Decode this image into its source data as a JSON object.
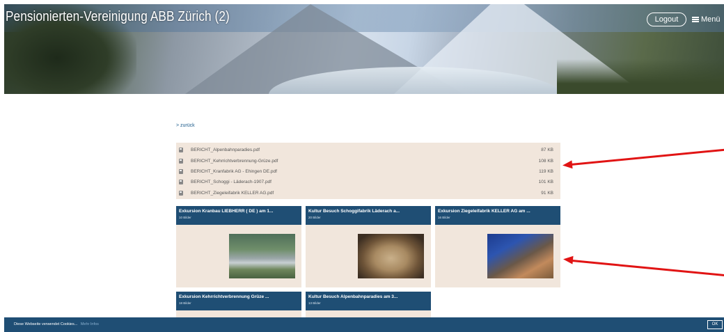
{
  "header": {
    "site_title": "Pensionierten-Vereinigung ABB Zürich (2)",
    "logout_label": "Logout",
    "menu_label": "Menü"
  },
  "nav": {
    "back_label": "> zurück"
  },
  "files": [
    {
      "name": "BERICHT_Alpenbahnparadies.pdf",
      "size": "87 KB",
      "icon": "pdf-icon"
    },
    {
      "name": "BERICHT_Kehrrichtverbrennung-Grüze.pdf",
      "size": "108 KB",
      "icon": "pdf-icon"
    },
    {
      "name": "BERICHT_Kranfabrik AG - Ehingen DE.pdf",
      "size": "119 KB",
      "icon": "pdf-icon"
    },
    {
      "name": "BERICHT_Schoggi - Läderach-1907.pdf",
      "size": "101 KB",
      "icon": "pdf-icon"
    },
    {
      "name": "BERICHT_Ziegeleifabrik KELLER AG.pdf",
      "size": "91 KB",
      "icon": "pdf-icon"
    }
  ],
  "galleries": [
    {
      "title": "Exkursion Kranbau LIEBHERR ( DE ) am 1...",
      "count": "10 Bilder"
    },
    {
      "title": "Kultur Besuch Schoggifabrik Läderach a...",
      "count": "20 Bilder"
    },
    {
      "title": "Exkursion Ziegeleifabrik KELLER AG am ...",
      "count": "16 Bilder"
    },
    {
      "title": "Exkursion Kehrrichtverbrennung Grüze ...",
      "count": "18 Bilder"
    },
    {
      "title": "Kultur Besuch Alpenbahnparadies am 3...",
      "count": "13 Bilder"
    }
  ],
  "cookie": {
    "text": "Diese Webseite verwendet Cookies...",
    "more_label": "Mehr Infos",
    "ok_label": "OK"
  },
  "colors": {
    "brand_blue": "#1f4e74",
    "panel_beige": "#f1e6dc",
    "annotation_red": "#e11414"
  }
}
